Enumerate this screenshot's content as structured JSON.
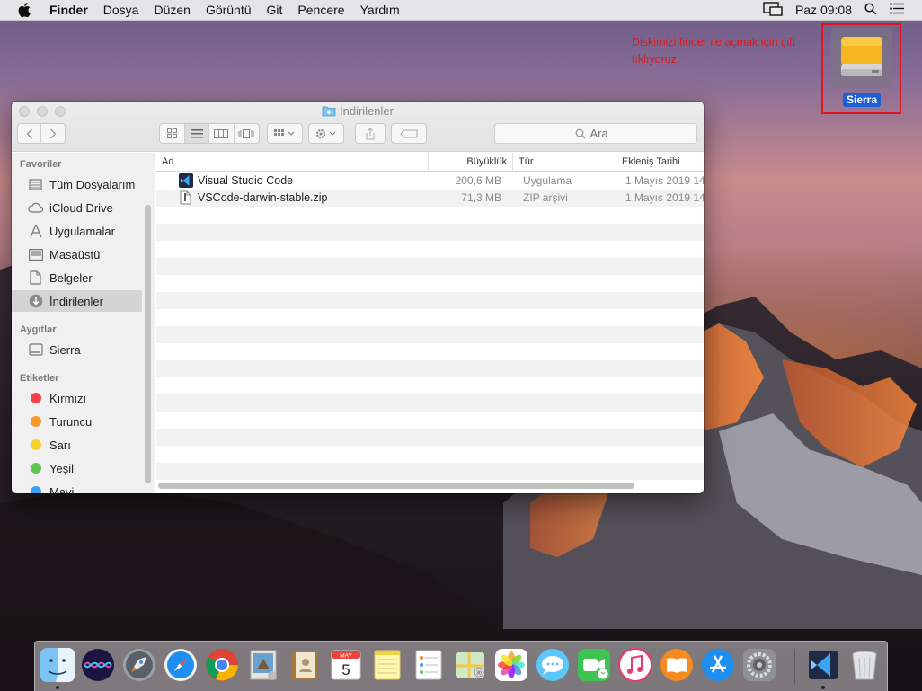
{
  "menubar": {
    "app_name": "Finder",
    "items": [
      "Dosya",
      "Düzen",
      "Görüntü",
      "Git",
      "Pencere",
      "Yardım"
    ],
    "clock": "Paz 09:08"
  },
  "desktop": {
    "disk_label": "Sierra",
    "annotation": "Diskimizi finder ile açmak için çift tıklıyoruz.",
    "annotation_color": "#e0161f"
  },
  "window": {
    "title": "İndirilenler",
    "search_placeholder": "Ara",
    "sidebar": {
      "sections": [
        {
          "header": "Favoriler",
          "items": [
            {
              "label": "Tüm Dosyalarım",
              "icon": "all-files-icon"
            },
            {
              "label": "iCloud Drive",
              "icon": "cloud-icon"
            },
            {
              "label": "Uygulamalar",
              "icon": "applications-icon"
            },
            {
              "label": "Masaüstü",
              "icon": "desktop-icon"
            },
            {
              "label": "Belgeler",
              "icon": "documents-icon"
            },
            {
              "label": "İndirilenler",
              "icon": "downloads-icon",
              "selected": true
            }
          ]
        },
        {
          "header": "Aygıtlar",
          "items": [
            {
              "label": "Sierra",
              "icon": "disk-icon"
            }
          ]
        },
        {
          "header": "Etiketler",
          "items": [
            {
              "label": "Kırmızı",
              "color": "#f2434b"
            },
            {
              "label": "Turuncu",
              "color": "#f6982e"
            },
            {
              "label": "Sarı",
              "color": "#f5d22c"
            },
            {
              "label": "Yeşil",
              "color": "#62c554"
            },
            {
              "label": "Mavi",
              "color": "#3a9ef5"
            }
          ]
        }
      ]
    },
    "columns": [
      "Ad",
      "Büyüklük",
      "Tür",
      "Ekleniş Tarihi"
    ],
    "files": [
      {
        "name": "Visual Studio Code",
        "size": "200,6 MB",
        "kind": "Uygulama",
        "date": "1 Mayıs 2019 14",
        "icon": "vscode-icon"
      },
      {
        "name": "VSCode-darwin-stable.zip",
        "size": "71,3 MB",
        "kind": "ZIP arşivi",
        "date": "1 Mayıs 2019 14",
        "icon": "zip-file-icon"
      }
    ]
  },
  "dock": {
    "calendar_month": "MAY",
    "calendar_day": "5",
    "apps": [
      "finder",
      "siri",
      "launchpad",
      "safari",
      "chrome",
      "mail",
      "contacts",
      "calendar",
      "notes",
      "reminders",
      "maps",
      "photos",
      "messages",
      "facetime",
      "itunes",
      "ibooks",
      "app-store",
      "system-preferences",
      "vscode",
      "trash"
    ]
  }
}
